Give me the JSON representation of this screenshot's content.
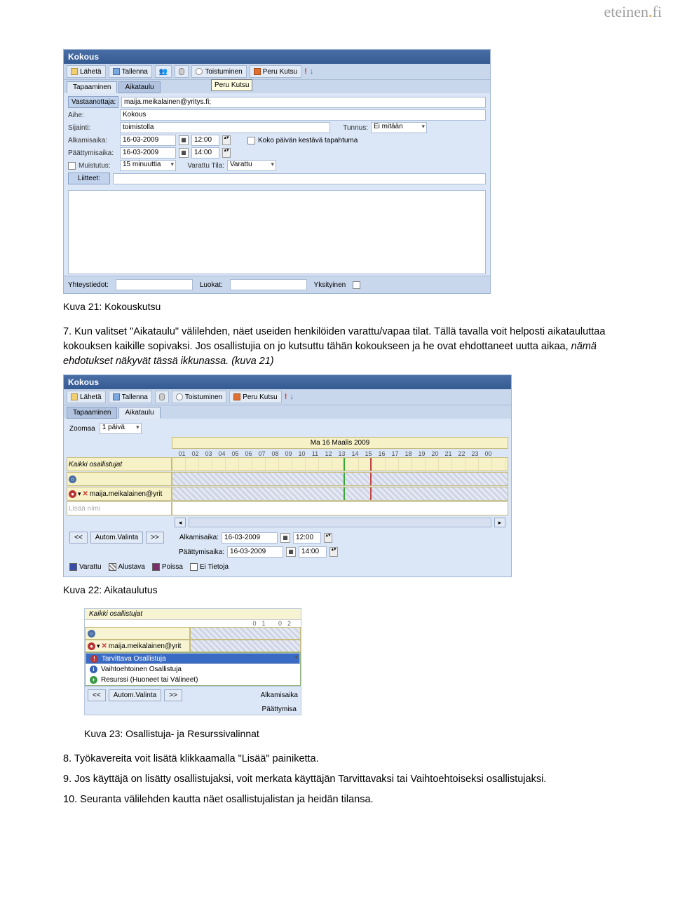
{
  "brand": {
    "pre": "eteinen",
    "dot": ".",
    "fi": "fi"
  },
  "shot1": {
    "title": "Kokous",
    "toolbar": {
      "send": "Lähetä",
      "save": "Tallenna",
      "recur": "Toistuminen",
      "cancel_invite": "Peru Kutsu"
    },
    "tooltip": "Peru Kutsu",
    "tabs": {
      "appointment": "Tapaaminen",
      "schedule": "Aikataulu"
    },
    "labels": {
      "recipient_btn": "Vastaanottaja:",
      "subject": "Aihe:",
      "location": "Sijainti:",
      "token": "Tunnus:",
      "start": "Alkamisaika:",
      "end": "Päättymisaika:",
      "allday": "Koko päivän kestävä tapahtuma",
      "reminder": "Muistutus:",
      "busy_status": "Varattu Tila:",
      "attachments": "Liitteet:",
      "contacts": "Yhteystiedot:",
      "categories": "Luokat:",
      "private": "Yksityinen"
    },
    "values": {
      "recipient": "maija.meikalainen@yritys.fi;",
      "subject": "Kokous",
      "location": "toimistolla",
      "token": "Ei mitään",
      "start_date": "16-03-2009",
      "start_time": "12:00",
      "end_date": "16-03-2009",
      "end_time": "14:00",
      "reminder": "15 minuuttia",
      "busy": "Varattu"
    }
  },
  "caption21": "Kuva 21: Kokouskutsu",
  "para7": "7. Kun valitset \"Aikataulu\" välilehden, näet useiden henkilöiden varattu/vapaa tilat. Tällä tavalla voit helposti aikatauluttaa kokouksen kaikille sopivaksi. Jos osallistujia on jo kutsuttu tähän kokoukseen ja he ovat ehdottaneet uutta aikaa, nämä ehdotukset näkyvät tässä ikkunassa. (kuva 21)",
  "para7_italic": "nämä ehdotukset näkyvät tässä ikkunassa. (kuva 21)",
  "shot2": {
    "title": "Kokous",
    "toolbar": {
      "send": "Lähetä",
      "save": "Tallenna",
      "recur": "Toistuminen",
      "cancel_invite": "Peru Kutsu"
    },
    "tabs": {
      "appointment": "Tapaaminen",
      "schedule": "Aikataulu"
    },
    "zoom_label": "Zoomaa",
    "zoom_value": "1 päivä",
    "day_header": "Ma 16 Maalis 2009",
    "hours": [
      "01",
      "02",
      "03",
      "04",
      "05",
      "06",
      "07",
      "08",
      "09",
      "10",
      "11",
      "12",
      "13",
      "14",
      "15",
      "16",
      "17",
      "18",
      "19",
      "20",
      "21",
      "22",
      "23",
      "00"
    ],
    "rows": {
      "all": "Kaikki osallistujat",
      "attendee": "maija.meikalainen@yrit",
      "add": "Lisää nimi"
    },
    "auto": {
      "prev": "<<",
      "btn": "Autom.Valinta",
      "next": ">>",
      "start_label": "Alkamisaika:",
      "start_date": "16-03-2009",
      "start_time": "12:00",
      "end_label": "Päättymisaika:",
      "end_date": "16-03-2009",
      "end_time": "14:00"
    },
    "legend": {
      "varattu": "Varattu",
      "alustava": "Alustava",
      "poissa": "Poissa",
      "ei": "Ei Tietoja"
    }
  },
  "caption22": "Kuva 22: Aikataulutus",
  "shot3": {
    "header_all": "Kaikki osallistujat",
    "hours": "01   02",
    "attendee": "maija.meikalainen@yrit",
    "menu": {
      "req": "Tarvittava Osallistuja",
      "opt": "Vaihtoehtoinen Osallistuja",
      "res": "Resurssi (Huoneet tai Välineet)"
    },
    "auto": {
      "prev": "<<",
      "btn": "Autom.Valinta",
      "next": ">>",
      "start": "Alkamisaika"
    },
    "end_label": "Päättymisa"
  },
  "caption23": "Kuva 23: Osallistuja- ja Resurssivalinnat",
  "para8": "8. Työkavereita voit lisätä klikkaamalla \"Lisää\" painiketta.",
  "para9": "9. Jos käyttäjä on lisätty osallistujaksi, voit merkata käyttäjän Tarvittavaksi tai Vaihtoehtoiseksi osallistujaksi.",
  "para10": "10. Seuranta välilehden kautta näet osallistujalistan ja heidän tilansa."
}
